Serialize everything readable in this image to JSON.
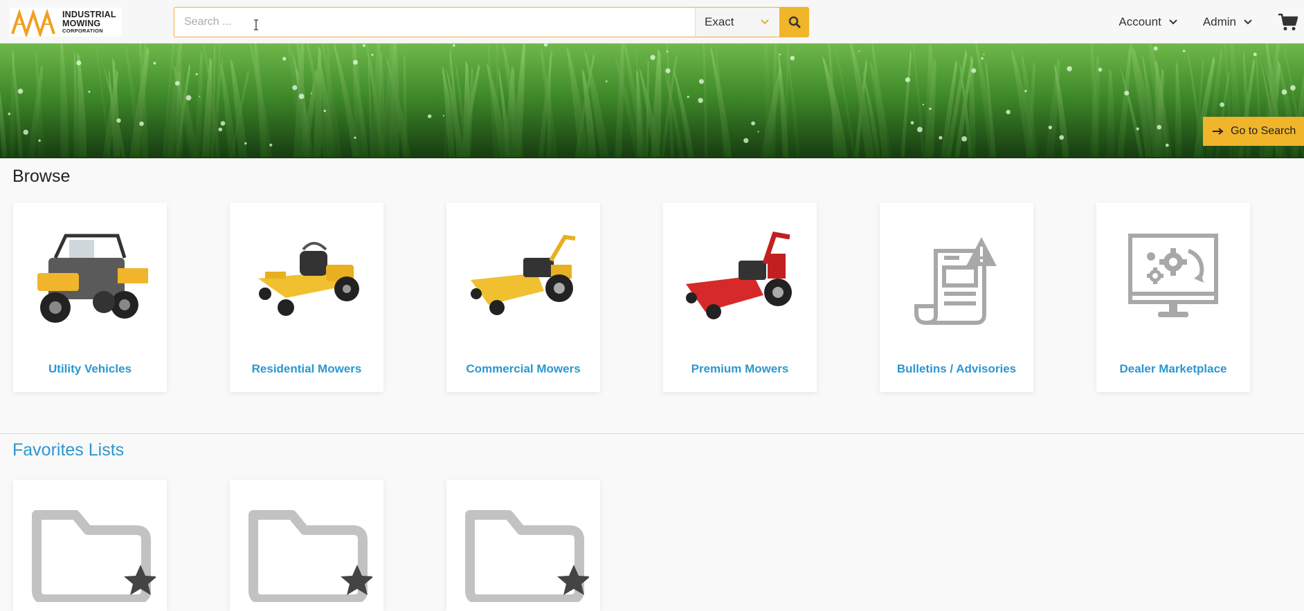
{
  "brand": {
    "line1": "INDUSTRIAL",
    "line2": "MOWING",
    "line3": "CORPORATION"
  },
  "search": {
    "placeholder": "Search ...",
    "match_mode": "Exact"
  },
  "nav": {
    "account_label": "Account",
    "admin_label": "Admin"
  },
  "banner": {
    "go_search_label": "Go to Search"
  },
  "browse": {
    "title": "Browse",
    "items": [
      {
        "label": "Utility Vehicles",
        "icon": "utility-vehicle-image"
      },
      {
        "label": "Residential Mowers",
        "icon": "yellow-zero-turn-mower-image"
      },
      {
        "label": "Commercial Mowers",
        "icon": "yellow-walk-behind-mower-image"
      },
      {
        "label": "Premium Mowers",
        "icon": "red-walk-behind-mower-image"
      },
      {
        "label": "Bulletins / Advisories",
        "icon": "document-warning-icon"
      },
      {
        "label": "Dealer Marketplace",
        "icon": "monitor-gears-icon"
      }
    ]
  },
  "favorites": {
    "title": "Favorites Lists",
    "items": [
      {
        "icon": "star-folder-icon"
      },
      {
        "icon": "star-folder-icon"
      },
      {
        "icon": "star-folder-icon"
      }
    ]
  },
  "colors": {
    "accent": "#f0b52a",
    "link": "#2b97cf",
    "icon_gray": "#a8a8a8"
  }
}
